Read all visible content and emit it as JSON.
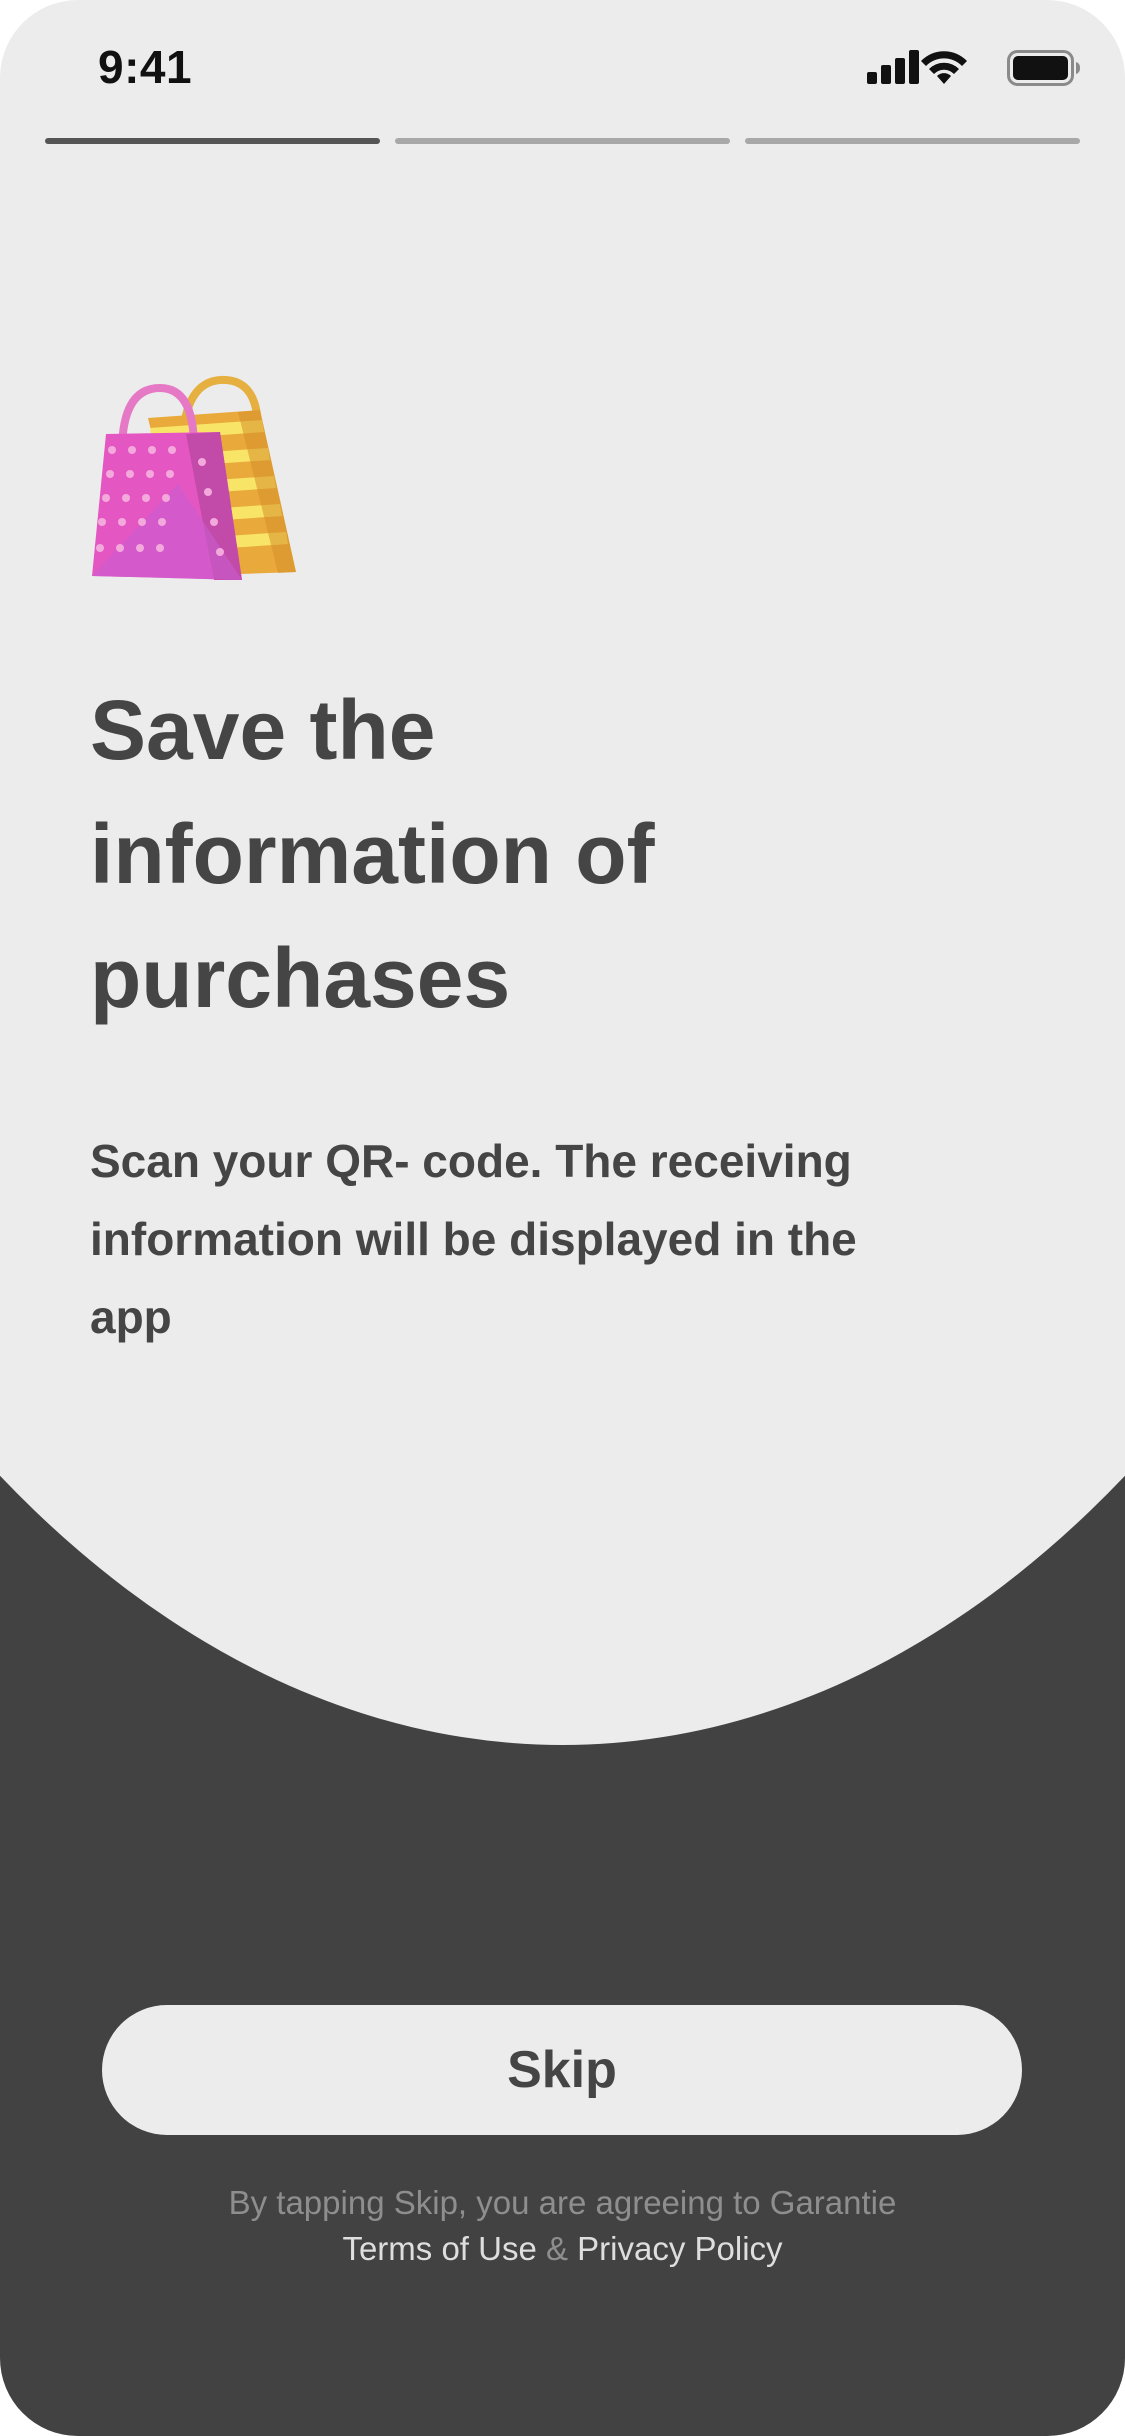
{
  "status_bar": {
    "time": "9:41",
    "icons": [
      "cellular-signal-icon",
      "wifi-icon",
      "battery-icon"
    ]
  },
  "onboarding": {
    "step_total": 3,
    "step_current": 1,
    "illustration": "shopping-bags-icon",
    "headline": "Save the information of purchases",
    "subtext": "Scan your QR- code. The receiving information will be displayed in the app"
  },
  "actions": {
    "skip_label": "Skip"
  },
  "legal": {
    "prefix": "By tapping Skip, you are agreeing to Garantie",
    "terms_link": "Terms of Use",
    "separator": "&",
    "privacy_link": "Privacy Policy"
  },
  "colors": {
    "background_light": "#ececec",
    "background_dark": "#424242",
    "text_primary": "#454545",
    "progress_active": "#555555",
    "progress_inactive": "#a8a8a8"
  }
}
